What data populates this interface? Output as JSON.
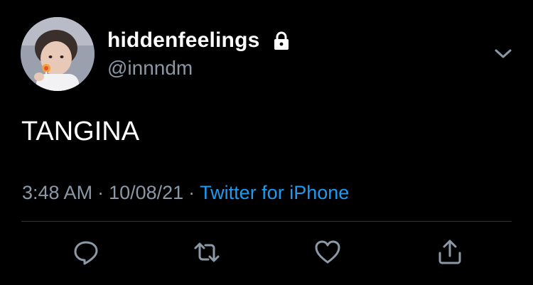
{
  "user": {
    "display_name": "hiddenfeelings",
    "handle": "@innndm",
    "protected_icon": "lock-icon",
    "avatar": "profile-photo"
  },
  "tweet": {
    "text": "TANGINA",
    "time": "3:48 AM",
    "date": "10/08/21",
    "separator": "·",
    "source": "Twitter for iPhone"
  },
  "actions": [
    {
      "name": "reply",
      "icon": "reply-icon"
    },
    {
      "name": "retweet",
      "icon": "retweet-icon"
    },
    {
      "name": "like",
      "icon": "heart-icon"
    },
    {
      "name": "share",
      "icon": "share-icon"
    }
  ],
  "menu": {
    "icon": "chevron-down-icon"
  },
  "colors": {
    "background": "#000000",
    "primary_text": "#ffffff",
    "secondary_text": "#8b98a5",
    "link": "#1d9bf0",
    "divider": "#2f3336"
  }
}
